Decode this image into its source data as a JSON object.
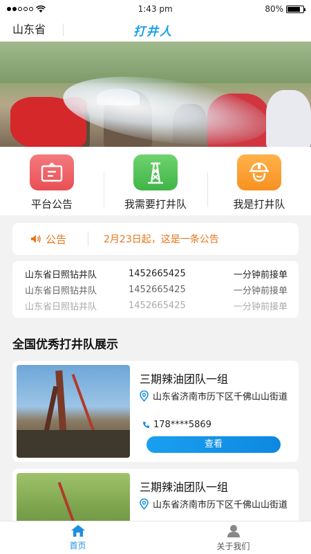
{
  "status_bar": {
    "time": "1:43 pm",
    "battery": "80%",
    "battery_level": 0.8
  },
  "header": {
    "province": "山东省",
    "brand": "打井人"
  },
  "quick_actions": [
    {
      "label": "平台公告",
      "icon": "announcement-board-icon",
      "color": "#e94f55"
    },
    {
      "label": "我需要打井队",
      "icon": "drilling-tower-icon",
      "color": "#3fb546"
    },
    {
      "label": "我是打井队",
      "icon": "worker-helmet-icon",
      "color": "#f79120"
    }
  ],
  "notice": {
    "label": "公告",
    "text": "2月23日起，这是一条公告"
  },
  "orders": [
    {
      "team": "山东省日照钻井队",
      "phone": "1452665425",
      "time": "一分钟前接单"
    },
    {
      "team": "山东省日照钻井队",
      "phone": "1452665425",
      "time": "一分钟前接单"
    },
    {
      "team": "山东省日照钻井队",
      "phone": "1452665425",
      "time": "一分钟前接单"
    }
  ],
  "section_title": "全国优秀打井队展示",
  "teams": [
    {
      "name": "三期辣油团队一组",
      "address": "山东省济南市历下区千佛山山街道",
      "phone": "178****5869",
      "button": "查看"
    },
    {
      "name": "三期辣油团队一组",
      "address": "山东省济南市历下区千佛山山街道",
      "phone": "",
      "button": ""
    }
  ],
  "tabs": [
    {
      "label": "首页",
      "icon": "home-icon",
      "active": true
    },
    {
      "label": "关于我们",
      "icon": "user-icon",
      "active": false
    }
  ],
  "colors": {
    "accent": "#1c8fe0",
    "notice": "#e8751a"
  }
}
